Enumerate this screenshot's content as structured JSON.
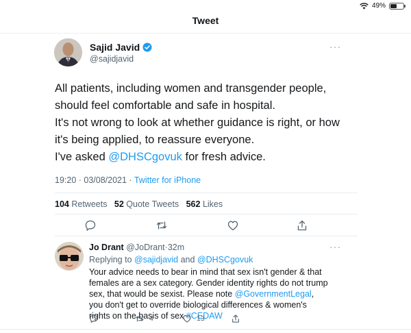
{
  "status_bar": {
    "battery": "49%",
    "battery_level": 0.49
  },
  "header": {
    "title": "Tweet"
  },
  "tweet": {
    "author_name": "Sajid Javid",
    "author_handle": "@sajidjavid",
    "paragraphs": [
      "All patients, including women and transgender people, should feel comfortable and safe in hospital.",
      "It's not wrong to look at whether guidance is right, or how it's being applied, to reassure everyone."
    ],
    "para3_prefix": "I've asked ",
    "para3_mention": "@DHSCgovuk",
    "para3_suffix": " for fresh advice.",
    "time": "19:20 · 03/08/2021",
    "meta_sep": " · ",
    "source": "Twitter for iPhone",
    "retweets_count": "104",
    "retweets_label": "Retweets",
    "quotes_count": "52",
    "quotes_label": "Quote Tweets",
    "likes_count": "562",
    "likes_label": "Likes"
  },
  "reply": {
    "author_name": "Jo Drant",
    "author_handle": "@JoDrant",
    "time_ago": "32m",
    "replying_prefix": "Replying to ",
    "replying_user1": "@sajidjavid",
    "replying_and": " and ",
    "replying_user2": "@DHSCgovuk",
    "text_part1": "Your advice needs to bear in mind that sex isn't gender & that females are a sex category. Gender identity rights do not trump sex, that would be sexist. Please note ",
    "text_mention": "@GovernmentLegal",
    "text_part2": ", you don't get to override biological differences & women's rights on the basis of sex ",
    "text_hashtag": "#CEDAW",
    "retweet_count": "4",
    "like_count": "13"
  },
  "colors": {
    "accent": "#1d9bf0",
    "muted": "#536471",
    "text": "#0f1419"
  }
}
